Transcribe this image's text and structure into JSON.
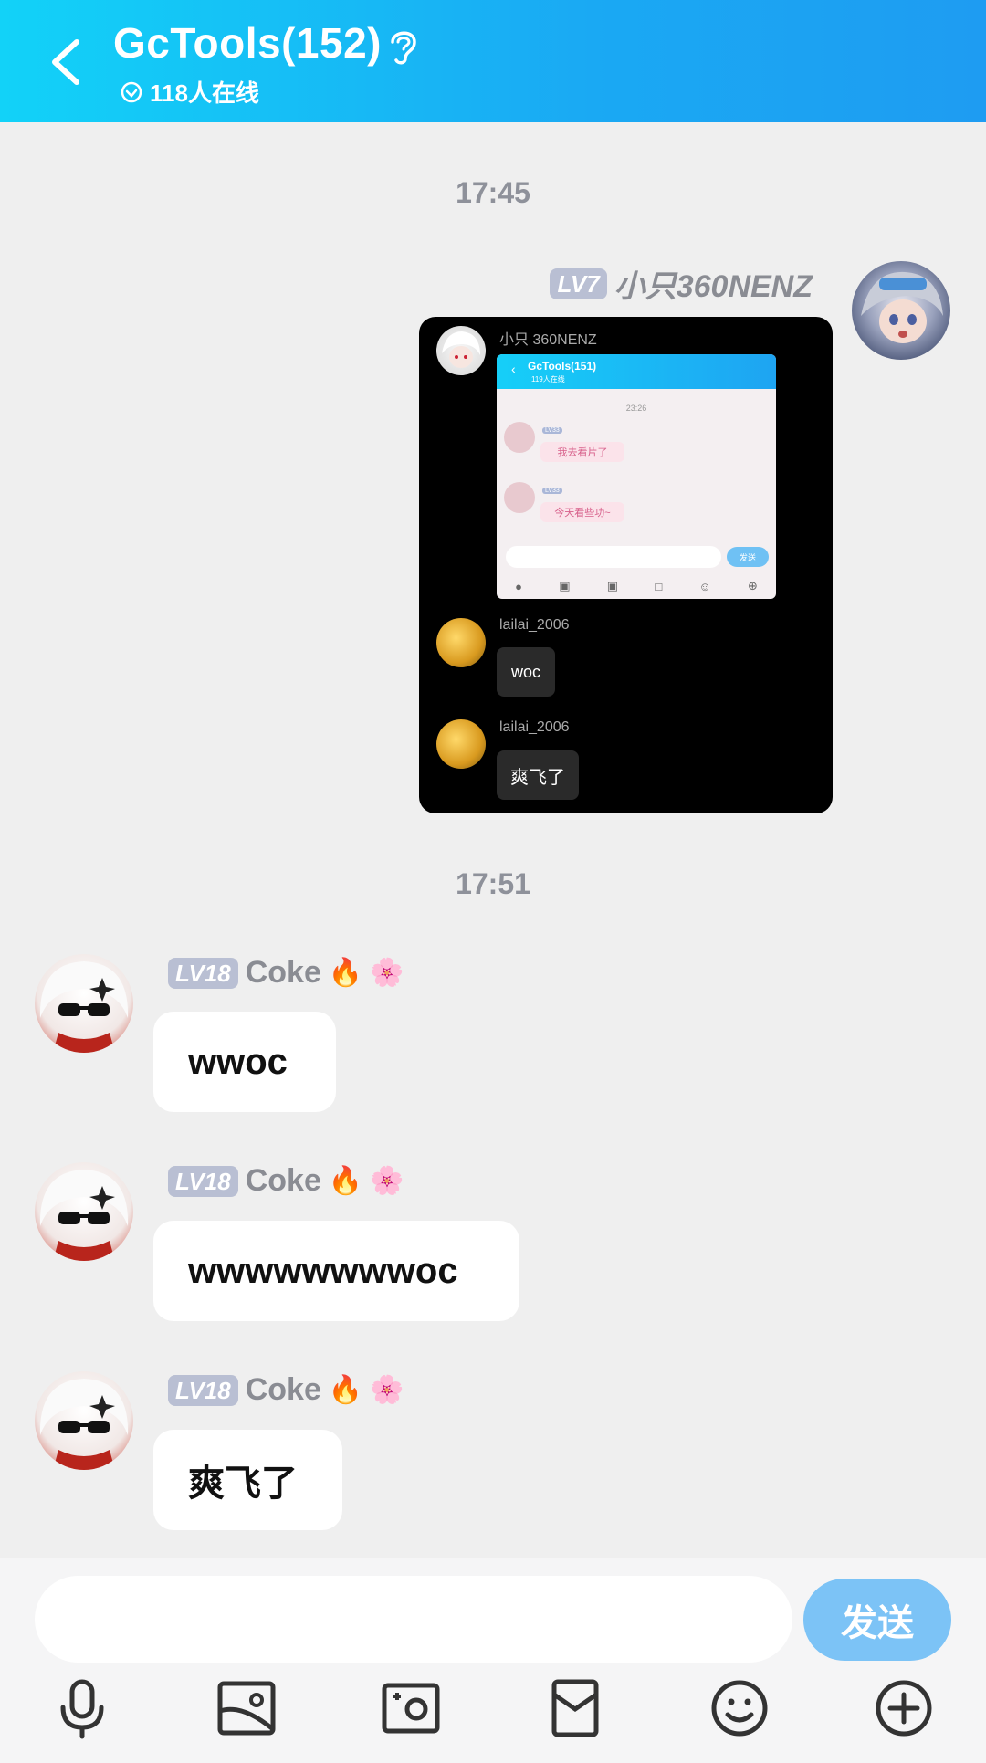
{
  "header": {
    "title": "GcTools(152)",
    "online": "118人在线"
  },
  "chat": {
    "time1": "17:45",
    "time2": "17:51",
    "msg_self": {
      "level": "LV7",
      "name": "小只360NENZ"
    },
    "forwarded": {
      "sender_name": "小只 360NENZ",
      "inner_title": "GcTools(151)",
      "inner_online": "119人在线",
      "inner_time": "23:26",
      "inner_level": "LV33",
      "inner_msg1": "我去看片了",
      "inner_msg2": "今天看些功~",
      "inner_send": "发送",
      "user": "lailai_2006",
      "msg1": "woc",
      "msg2": "爽飞了"
    },
    "coke_messages": [
      {
        "level": "LV18",
        "name": "Coke",
        "text": "wwoc"
      },
      {
        "level": "LV18",
        "name": "Coke",
        "text": "wwwwwwwwoc"
      },
      {
        "level": "LV18",
        "name": "Coke",
        "text": "爽飞了"
      }
    ]
  },
  "input_bar": {
    "placeholder": "",
    "send_label": "发送"
  },
  "toolbar": [
    "microphone-icon",
    "image-icon",
    "camera-icon",
    "red-packet-icon",
    "emoji-icon",
    "plus-icon"
  ],
  "colors": {
    "header_start": "#12d2f8",
    "header_end": "#1e9cf2",
    "send_button": "#7cc3f6",
    "level_badge": "#b9bfd3"
  }
}
